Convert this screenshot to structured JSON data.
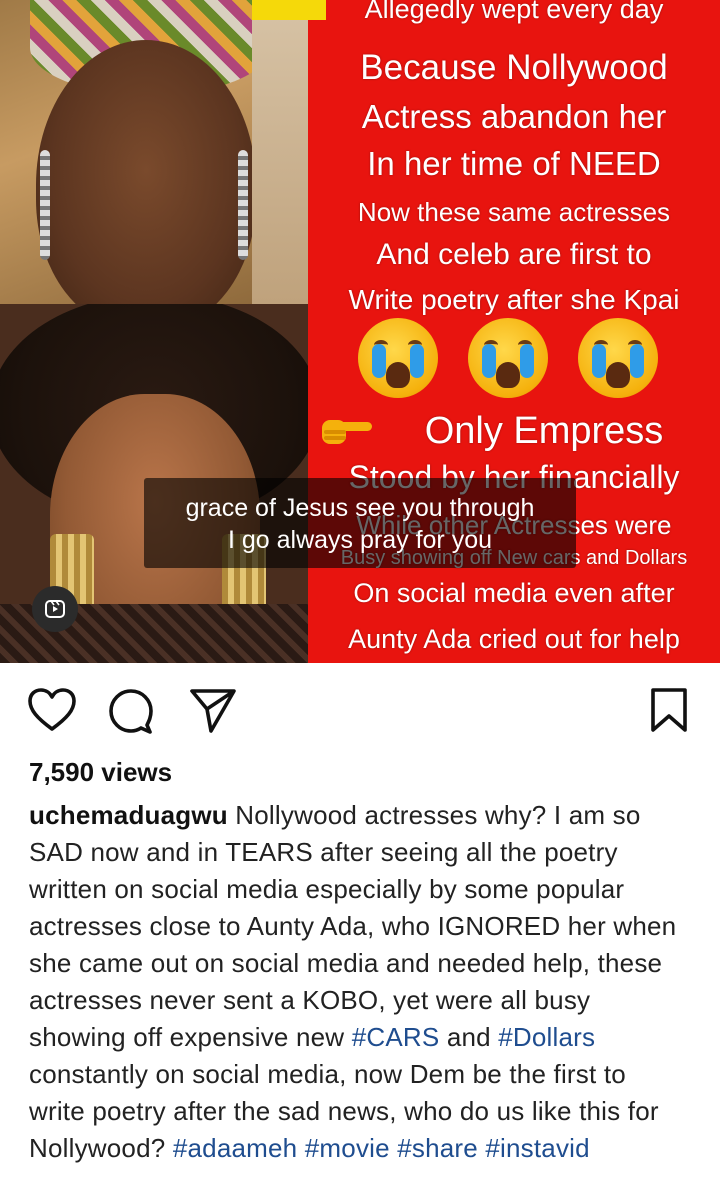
{
  "media": {
    "overlay_lines": [
      {
        "text": "Allegedly wept every day",
        "size": 27
      },
      {
        "text": "Because Nollywood",
        "size": 35
      },
      {
        "text": "Actress abandon her",
        "size": 33
      },
      {
        "text": "In her time of NEED",
        "size": 33
      },
      {
        "text": "Now these same actresses",
        "size": 26
      },
      {
        "text": "And celeb are first to",
        "size": 30
      },
      {
        "text": "Write poetry after she Kpai",
        "size": 28
      },
      {
        "text": "Only Empress",
        "size": 38
      },
      {
        "text": "Stood by her financially",
        "size": 32
      },
      {
        "text": "While other Actresses were",
        "size": 26
      },
      {
        "text": "Busy showing off New cars and Dollars",
        "size": 20
      },
      {
        "text": "On social media even after",
        "size": 27
      },
      {
        "text": "Aunty Ada cried out for help",
        "size": 27
      }
    ],
    "emoji_names": [
      "loudly-crying-face",
      "loudly-crying-face",
      "loudly-crying-face"
    ],
    "pointing_emoji": "backhand-index-pointing-right",
    "subtitle_line1": "grace of Jesus see you through",
    "subtitle_line2": "I go always pray for you",
    "reel_icon": "reels-icon",
    "colors": {
      "background": "#e8140f",
      "accent_bar": "#f5d90a"
    }
  },
  "actions": {
    "like_icon": "heart-icon",
    "comment_icon": "comment-icon",
    "share_icon": "send-icon",
    "save_icon": "bookmark-icon"
  },
  "post": {
    "views": "7,590 views",
    "username": "uchemaduagwu",
    "body_1": " Nollywood actresses why? I am so SAD now and in TEARS after seeing all the poetry written on social media especially by some popular actresses close to Aunty Ada, who IGNORED her when she came out on social media and needed help, these actresses never sent a KOBO, yet were all busy showing off expensive new ",
    "tag_cars": "#CARS",
    "body_2": " and ",
    "tag_dollars": "#Dollars",
    "body_3": " constantly on social media, now Dem be the first to write poetry after the sad news, who do us like this for Nollywood? ",
    "tag_adaameh": "#adaameh",
    "tag_movie": "#movie",
    "tag_share": "#share",
    "tag_instavid": "#instavid",
    "colors": {
      "hashtag": "#1f4d8f",
      "text": "#222222"
    }
  }
}
